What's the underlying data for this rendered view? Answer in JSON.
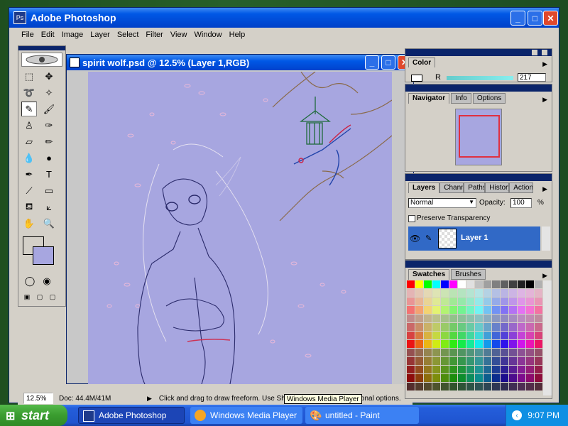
{
  "app": {
    "title": "Adobe Photoshop"
  },
  "menu": [
    "File",
    "Edit",
    "Image",
    "Layer",
    "Select",
    "Filter",
    "View",
    "Window",
    "Help"
  ],
  "document": {
    "title": "spirit wolf.psd @ 12.5% (Layer 1,RGB)"
  },
  "status": {
    "zoom": "12.5%",
    "doc": "Doc: 44.4M/41M",
    "hint": "Click and drag to draw freeform.  Use Shift, Alt, and Ctrl for additional options."
  },
  "color_panel": {
    "title": "Color",
    "channel": "R",
    "value": "217"
  },
  "navigator_panel": {
    "tabs": [
      "Navigator",
      "Info",
      "Options"
    ]
  },
  "layers_panel": {
    "tabs": [
      "Layers",
      "Channels",
      "Paths",
      "History",
      "Actions"
    ],
    "blend_mode": "Normal",
    "opacity_label": "Opacity:",
    "opacity_value": "100",
    "opacity_unit": "%",
    "preserve_label": "Preserve Transparency",
    "layer_name": "Layer 1"
  },
  "swatches_panel": {
    "tabs": [
      "Swatches",
      "Brushes"
    ]
  },
  "taskbar": {
    "start": "start",
    "items": [
      "Adobe Photoshop",
      "Windows Media Player",
      "untitled - Paint"
    ],
    "tooltip": "Windows Media Player",
    "clock": "9:07 PM"
  },
  "colors": {
    "canvas": "#a7a6e0",
    "titlebar": "#0058e6",
    "layer_selected": "#3169c6"
  }
}
